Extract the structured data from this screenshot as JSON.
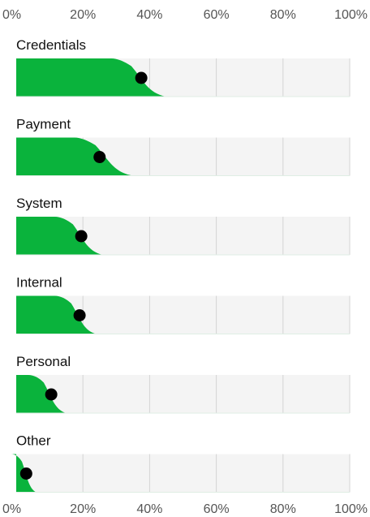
{
  "chart_data": {
    "type": "area",
    "xlim": [
      0,
      100
    ],
    "x_ticks": [
      "0%",
      "20%",
      "40%",
      "60%",
      "80%",
      "100%"
    ],
    "series_color": "#0ab33c",
    "marker_color": "#000000",
    "panel_color": "#f4f4f4",
    "grid": true,
    "categories": [
      {
        "name": "Credentials",
        "marker": 37.5,
        "plateau_end": 31,
        "tail_end": 45
      },
      {
        "name": "Payment",
        "marker": 25,
        "plateau_end": 20,
        "tail_end": 35
      },
      {
        "name": "System",
        "marker": 19.5,
        "plateau_end": 14,
        "tail_end": 26
      },
      {
        "name": "Internal",
        "marker": 19,
        "plateau_end": 14,
        "tail_end": 24
      },
      {
        "name": "Personal",
        "marker": 10.5,
        "plateau_end": 6,
        "tail_end": 15
      },
      {
        "name": "Other",
        "marker": 3,
        "plateau_end": 0.3,
        "tail_end": 6
      }
    ]
  }
}
